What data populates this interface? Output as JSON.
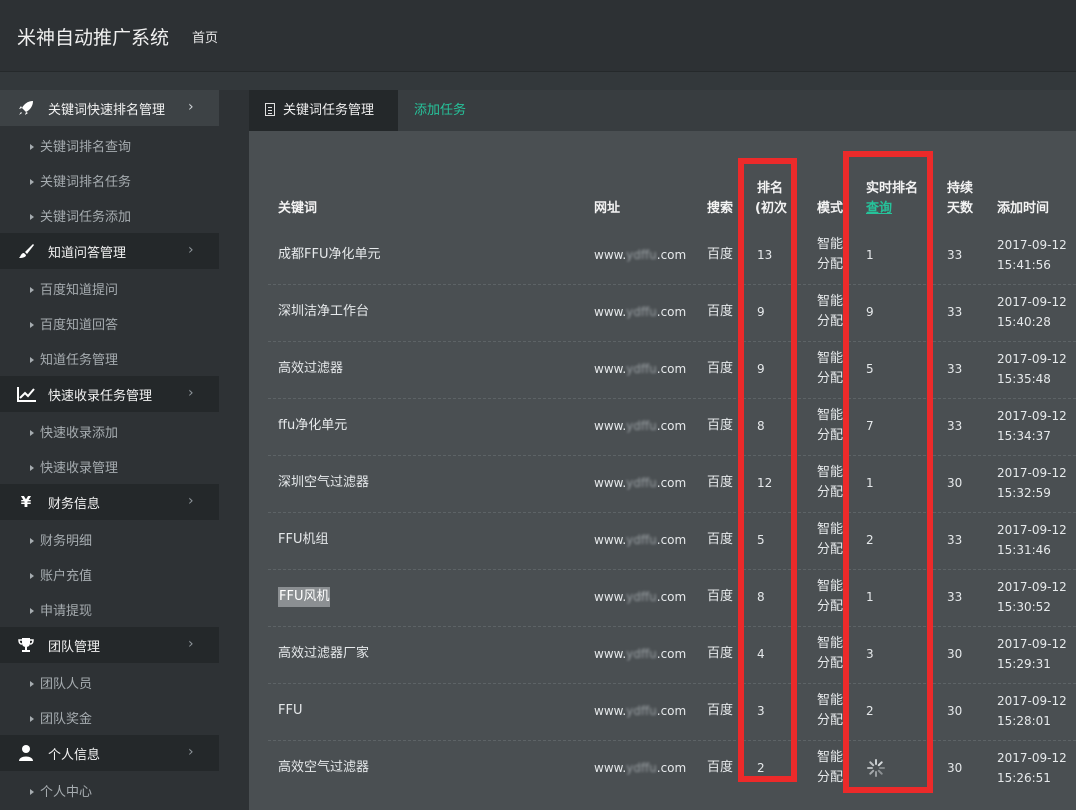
{
  "app": {
    "title": "米神自动推广系统",
    "home_link": "首页"
  },
  "sidebar": {
    "groups": [
      {
        "icon": "rocket-icon",
        "label": "关键词快速排名管理",
        "items": [
          "关键词排名查询",
          "关键词排名任务",
          "关键词任务添加"
        ]
      },
      {
        "icon": "brush-icon",
        "label": "知道问答管理",
        "items": [
          "百度知道提问",
          "百度知道回答",
          "知道任务管理"
        ]
      },
      {
        "icon": "line-chart-icon",
        "label": "快速收录任务管理",
        "items": [
          "快速收录添加",
          "快速收录管理"
        ]
      },
      {
        "icon": "yen-icon",
        "label": "财务信息",
        "items": [
          "财务明细",
          "账户充值",
          "申请提现"
        ]
      },
      {
        "icon": "trophy-icon",
        "label": "团队管理",
        "items": [
          "团队人员",
          "团队奖金"
        ]
      },
      {
        "icon": "user-icon",
        "label": "个人信息",
        "items": [
          "个人中心"
        ]
      }
    ]
  },
  "tabs": {
    "active": "关键词任务管理",
    "add": "添加任务"
  },
  "table": {
    "headers": {
      "keyword": "关键词",
      "url": "网址",
      "search": "搜索",
      "rank_initial_1": "排名",
      "rank_initial_2": "(初次",
      "mode": "模式",
      "realtime_rank": "实时排名",
      "realtime_query": "查询",
      "days_1": "持续",
      "days_2": "天数",
      "added_time": "添加时间"
    },
    "rows": [
      {
        "keyword": "成都FFU净化单元",
        "url_prefix": "www.",
        "url_blur": "ydffu",
        "url_suffix": ".com",
        "engine": "百度",
        "initial_rank": "13",
        "mode_1": "智能",
        "mode_2": "分配",
        "realtime_rank": "1",
        "days": "33",
        "date": "2017-09-12",
        "time": "15:41:56"
      },
      {
        "keyword": "深圳洁净工作台",
        "url_prefix": "www.",
        "url_blur": "ydffu",
        "url_suffix": ".com",
        "engine": "百度",
        "initial_rank": "9",
        "mode_1": "智能",
        "mode_2": "分配",
        "realtime_rank": "9",
        "days": "33",
        "date": "2017-09-12",
        "time": "15:40:28"
      },
      {
        "keyword": "高效过滤器",
        "url_prefix": "www.",
        "url_blur": "ydffu",
        "url_suffix": ".com",
        "engine": "百度",
        "initial_rank": "9",
        "mode_1": "智能",
        "mode_2": "分配",
        "realtime_rank": "5",
        "days": "33",
        "date": "2017-09-12",
        "time": "15:35:48"
      },
      {
        "keyword": "ffu净化单元",
        "url_prefix": "www.",
        "url_blur": "ydffu",
        "url_suffix": ".com",
        "engine": "百度",
        "initial_rank": "8",
        "mode_1": "智能",
        "mode_2": "分配",
        "realtime_rank": "7",
        "days": "33",
        "date": "2017-09-12",
        "time": "15:34:37"
      },
      {
        "keyword": "深圳空气过滤器",
        "url_prefix": "www.",
        "url_blur": "ydffu",
        "url_suffix": ".com",
        "engine": "百度",
        "initial_rank": "12",
        "mode_1": "智能",
        "mode_2": "分配",
        "realtime_rank": "1",
        "days": "30",
        "date": "2017-09-12",
        "time": "15:32:59"
      },
      {
        "keyword": "FFU机组",
        "url_prefix": "www.",
        "url_blur": "ydffu",
        "url_suffix": ".com",
        "engine": "百度",
        "initial_rank": "5",
        "mode_1": "智能",
        "mode_2": "分配",
        "realtime_rank": "2",
        "days": "33",
        "date": "2017-09-12",
        "time": "15:31:46"
      },
      {
        "keyword": "FFU风机",
        "url_prefix": "www.",
        "url_blur": "ydffu",
        "url_suffix": ".com",
        "engine": "百度",
        "initial_rank": "8",
        "mode_1": "智能",
        "mode_2": "分配",
        "realtime_rank": "1",
        "days": "33",
        "date": "2017-09-12",
        "time": "15:30:52"
      },
      {
        "keyword": "高效过滤器厂家",
        "url_prefix": "www.",
        "url_blur": "ydffu",
        "url_suffix": ".com",
        "engine": "百度",
        "initial_rank": "4",
        "mode_1": "智能",
        "mode_2": "分配",
        "realtime_rank": "3",
        "days": "30",
        "date": "2017-09-12",
        "time": "15:29:31"
      },
      {
        "keyword": "FFU",
        "url_prefix": "www.",
        "url_blur": "ydffu",
        "url_suffix": ".com",
        "engine": "百度",
        "initial_rank": "3",
        "mode_1": "智能",
        "mode_2": "分配",
        "realtime_rank": "2",
        "days": "30",
        "date": "2017-09-12",
        "time": "15:28:01"
      },
      {
        "keyword": "高效空气过滤器",
        "url_prefix": "www.",
        "url_blur": "ydffu",
        "url_suffix": ".com",
        "engine": "百度",
        "initial_rank": "2",
        "mode_1": "智能",
        "mode_2": "分配",
        "realtime_rank": "",
        "realtime_loading": true,
        "days": "30",
        "date": "2017-09-12",
        "time": "15:26:51"
      }
    ],
    "highlighted_row": 6
  },
  "colors": {
    "accent": "#26c29a",
    "annotation": "#ec2a2a"
  }
}
